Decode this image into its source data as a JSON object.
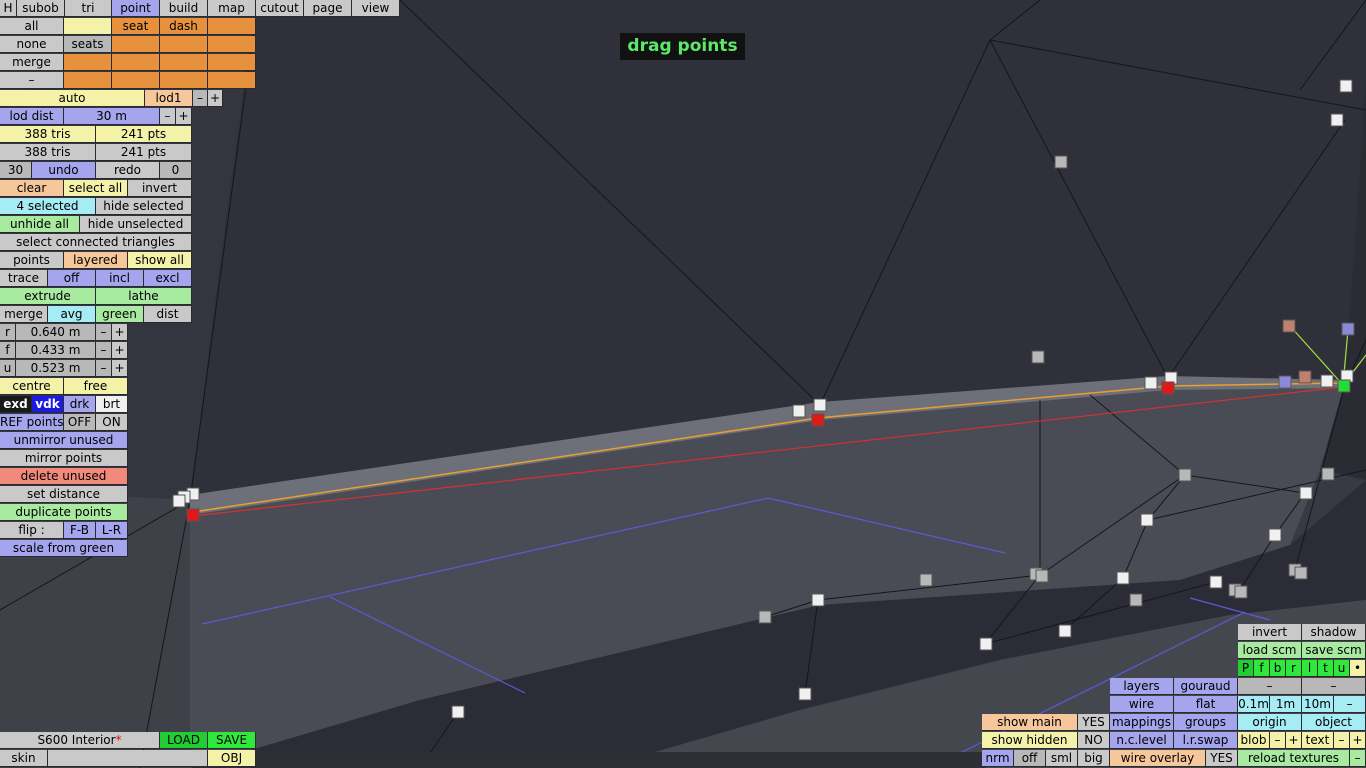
{
  "app": {
    "mode_label": "drag points"
  },
  "top_tabs": [
    "H",
    "subob",
    "tri",
    "point",
    "build",
    "map",
    "cutout",
    "page",
    "view"
  ],
  "select_grid": {
    "rows": [
      [
        "all",
        "",
        "seat",
        "dash"
      ],
      [
        "none",
        "seats",
        "",
        ""
      ],
      [
        "merge",
        "",
        "",
        ""
      ],
      [
        "–",
        "",
        "",
        ""
      ]
    ]
  },
  "lod": {
    "auto": "auto",
    "lod1": "lod1",
    "minus": "–",
    "plus": "+",
    "dist_label": "lod dist",
    "dist_value": "30 m"
  },
  "stats": {
    "tris_a": "388 tris",
    "pts_a": "241 pts",
    "tris_b": "388 tris",
    "pts_b": "241 pts"
  },
  "history": {
    "count": "30",
    "undo": "undo",
    "redo": "redo",
    "redo_count": "0"
  },
  "selection": {
    "clear": "clear",
    "select_all": "select all",
    "invert": "invert",
    "selected": "4 selected",
    "hide_selected": "hide selected",
    "unhide_all": "unhide all",
    "hide_unselected": "hide unselected",
    "select_connected": "select connected triangles"
  },
  "points_row": {
    "points": "points",
    "layered": "layered",
    "show_all": "show all"
  },
  "trace_row": {
    "trace": "trace",
    "off": "off",
    "incl": "incl",
    "excl": "excl"
  },
  "extrude_row": {
    "extrude": "extrude",
    "lathe": "lathe"
  },
  "merge_row": {
    "merge": "merge",
    "avg": "avg",
    "green": "green",
    "dist": "dist"
  },
  "rfu": [
    {
      "axis": "r",
      "value": "0.640 m"
    },
    {
      "axis": "f",
      "value": "0.433 m"
    },
    {
      "axis": "u",
      "value": "0.523 m"
    }
  ],
  "centre_row": {
    "centre": "centre",
    "free": "free"
  },
  "shade_row": {
    "exd": "exd",
    "vdk": "vdk",
    "drk": "drk",
    "brt": "brt"
  },
  "ref_row": {
    "ref": "REF points",
    "off": "OFF",
    "on": "ON"
  },
  "actions": {
    "unmirror": "unmirror unused",
    "mirror": "mirror points",
    "delete_unused": "delete unused",
    "set_distance": "set distance",
    "duplicate": "duplicate points",
    "flip": "flip :",
    "fb": "F-B",
    "lr": "L-R",
    "scale_green": "scale from green"
  },
  "file": {
    "name": "S600 Interior",
    "modified_mark": "*",
    "load": "LOAD",
    "save": "SAVE",
    "skin": "skin",
    "obj": "OBJ"
  },
  "bottom_right": {
    "invert": "invert",
    "shadow": "shadow",
    "load_scm": "load scm",
    "save_scm": "save scm",
    "flags": [
      "P",
      "f",
      "b",
      "r",
      "l",
      "t",
      "u",
      "•"
    ],
    "layers": "layers",
    "gouraud": "gouraud",
    "wire": "wire",
    "flat": "flat",
    "mappings": "mappings",
    "groups": "groups",
    "nclevel": "n.c.level",
    "lrswap": "l.r.swap",
    "wire_overlay": "wire overlay",
    "wire_overlay_val": "YES",
    "show_main": "show main",
    "show_main_val": "YES",
    "show_hidden": "show hidden",
    "show_hidden_val": "NO",
    "nrm": "nrm",
    "off": "off",
    "sml": "sml",
    "big": "big",
    "dash": "–",
    "d01": "0.1m",
    "d1": "1m",
    "d10": "10m",
    "minus": "–",
    "origin": "origin",
    "object": "object",
    "blob": "blob",
    "text": "text",
    "plus": "+",
    "reload": "reload textures"
  }
}
